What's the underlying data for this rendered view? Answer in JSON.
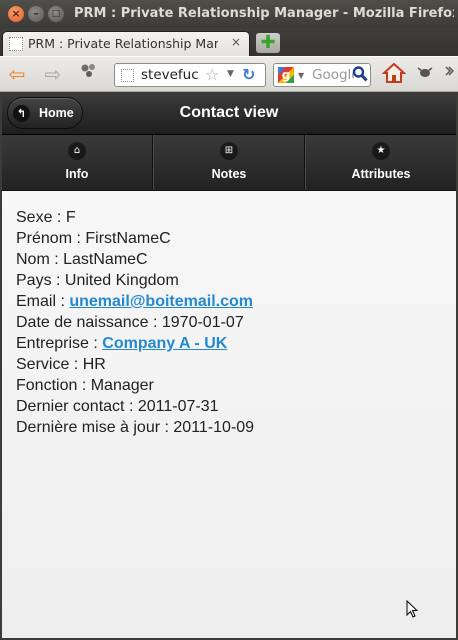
{
  "window": {
    "title": "PRM : Private Relationship Manager - Mozilla Firefox",
    "close_glyph": "×",
    "minimize_glyph": "–",
    "maximize_glyph": "□"
  },
  "tabs": [
    {
      "title": "PRM : Private Relationship Manager",
      "close_glyph": "×"
    }
  ],
  "new_tab_glyph": "✚",
  "toolbar": {
    "back_glyph": "⇦",
    "forward_glyph": "⇨",
    "url": "stevefuc",
    "star_glyph": "☆",
    "dropdown_glyph": "▼",
    "reload_glyph": "↻",
    "search_engine_glyph": "g",
    "search_placeholder": "Google",
    "search_glyph": "⚲",
    "home_glyph": "⌂"
  },
  "header": {
    "home_label": "Home",
    "home_icon_glyph": "↰",
    "title": "Contact view"
  },
  "navbar": [
    {
      "label": "Info",
      "icon": "home-icon",
      "glyph": "⌂"
    },
    {
      "label": "Notes",
      "icon": "grid-icon",
      "glyph": "⊞"
    },
    {
      "label": "Attributes",
      "icon": "star-icon",
      "glyph": "★"
    }
  ],
  "contact": {
    "sexe_label": "Sexe :",
    "sexe": "F",
    "prenom_label": "Prénom :",
    "prenom": "FirstNameC",
    "nom_label": "Nom :",
    "nom": "LastNameC",
    "pays_label": "Pays :",
    "pays": "United Kingdom",
    "email_label": "Email :",
    "email": "unemail@boitemail.com",
    "naissance_label": "Date de naissance :",
    "naissance": "1970-01-07",
    "entreprise_label": "Entreprise :",
    "entreprise": "Company A - UK",
    "service_label": "Service :",
    "service": "HR",
    "fonction_label": "Fonction :",
    "fonction": "Manager",
    "dernier_contact_label": "Dernier contact :",
    "dernier_contact": "2011-07-31",
    "maj_label": "Dernière mise à jour :",
    "maj": "2011-10-09"
  },
  "colors": {
    "link": "#2489ce",
    "header_bg": "#2a2a2a",
    "back_arrow": "#f08125"
  }
}
